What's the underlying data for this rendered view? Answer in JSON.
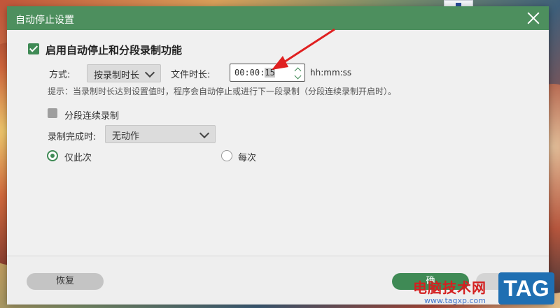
{
  "dialog": {
    "title": "自动停止设置",
    "enable_label": "启用自动停止和分段录制功能",
    "mode_label": "方式:",
    "mode_value": "按录制时长",
    "duration_label": "文件时长:",
    "time_prefix": "00:00:",
    "time_selected": "15",
    "time_format": "hh:mm:ss",
    "hint": "提示：当录制时长达到设置值时，程序会自动停止或进行下一段录制（分段连续录制开启时）。",
    "segment_label": "分段连续录制",
    "complete_label": "录制完成时:",
    "complete_value": "无动作",
    "radio_once": "仅此次",
    "radio_every": "每次",
    "reset_button": "恢复",
    "ok_button": "确"
  },
  "state": {
    "enable_checked": true,
    "segment_checked": false,
    "selected_radio": "radio_once"
  },
  "colors": {
    "accent": "#3f8a55",
    "titlebar": "#4d8f5e",
    "annotation_arrow": "#e02020"
  },
  "watermark": {
    "site_text": "电脑技术网",
    "site_url": "www.tagxp.com",
    "badge": "TAG"
  }
}
